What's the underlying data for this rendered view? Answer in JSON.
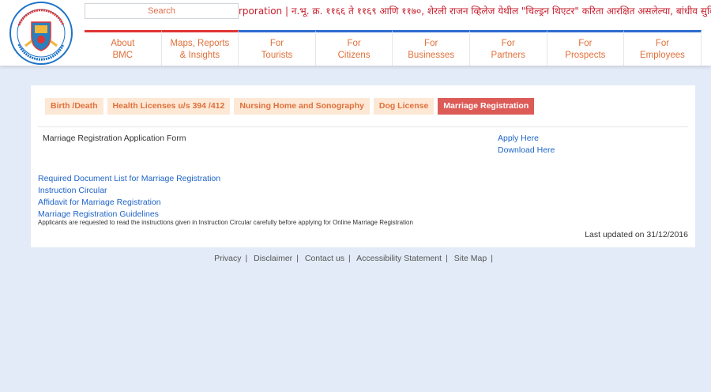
{
  "header": {
    "search": {
      "placeholder": "Search"
    },
    "ticker_text": "rporation | न.भू. क्र. ११६६ ते ११६९ आणि ११७०, शेरली राजन व्हिलेज येथील \"चिल्ड्रन थिएटर\" करिता आरक्षित असलेल्या, बांधीव सुविधेचे वाटप खाजगी संस्थेस",
    "logo": {
      "icon": "bmc-emblem-icon",
      "colors": {
        "ring": "#1e73c8",
        "shield": "#2a7fbf",
        "accent": "#e03535",
        "gold": "#f0b73a"
      }
    },
    "nav": [
      {
        "line1": "About",
        "line2": "BMC"
      },
      {
        "line1": "Maps, Reports",
        "line2": "& Insights"
      },
      {
        "line1": "For",
        "line2": "Tourists"
      },
      {
        "line1": "For",
        "line2": "Citizens"
      },
      {
        "line1": "For",
        "line2": "Businesses"
      },
      {
        "line1": "For",
        "line2": "Partners"
      },
      {
        "line1": "For",
        "line2": "Prospects"
      },
      {
        "line1": "For",
        "line2": "Employees"
      }
    ]
  },
  "tabs": [
    {
      "label": "Birth /Death"
    },
    {
      "label": "Health Licenses u/s 394 /412"
    },
    {
      "label": "Nursing Home and Sonography"
    },
    {
      "label": "Dog License"
    },
    {
      "label": "Marriage Registration",
      "active": true
    }
  ],
  "content": {
    "form_label": "Marriage Registration Application Form",
    "apply_link": "Apply Here",
    "download_link": "Download Here",
    "links": [
      "Required Document List for Marriage Registration",
      "Instruction Circular",
      "Affidavit for Marriage Registration",
      "Marriage Registration Guidelines"
    ],
    "note": "Applicants are requested to read the instructions given in Instruction Circular carefully before applying for Online Marriage Registration",
    "last_updated": "Last updated on 31/12/2016"
  },
  "footer": {
    "links": [
      "Privacy",
      "Disclaimer",
      "Contact us",
      "Accessibility Statement",
      "Site Map"
    ],
    "separator": "|"
  },
  "colors": {
    "accent_orange": "#e0703a",
    "active_tab": "#dd5b57",
    "link_blue": "#1e63c9",
    "nav_blue": "#2f6cd1",
    "nav_red": "#e03535",
    "page_bg": "#e2ebf7"
  }
}
